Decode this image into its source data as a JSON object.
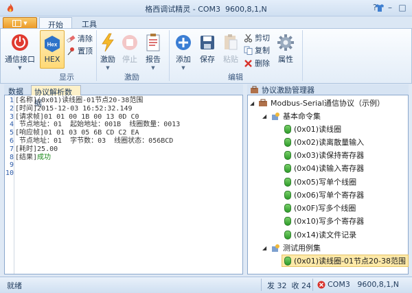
{
  "app_title": "格西调试精灵 - COM3  9600,8,1,N",
  "icons": [
    "flame-icon",
    "help-icon",
    "shirt-icon",
    "minimize-icon",
    "maximize-icon",
    "power-icon",
    "hex-icon",
    "eraser-icon",
    "pin-icon",
    "lightning-icon",
    "stop-icon",
    "report-icon",
    "add-icon",
    "save-icon",
    "paste-icon",
    "cut-icon",
    "copy-icon",
    "delete-icon",
    "gear-icon",
    "folder-icon",
    "toolbox-icon",
    "leaf-icon",
    "plug-icon"
  ],
  "ribbon": {
    "tabs": [
      "开始",
      "工具"
    ],
    "comm_port": "通信接口",
    "hex": "HEX",
    "hex_icon_text": "Hex",
    "clear": "清除",
    "pin_top": "置顶",
    "display_group": "显示",
    "stimulate": "激励",
    "stop": "停止",
    "report": "报告",
    "stimulate_group": "激励",
    "add": "添加",
    "save": "保存",
    "paste": "粘贴",
    "cut": "剪切",
    "copy": "复制",
    "delete": "删除",
    "properties": "属性",
    "edit_group": "编辑"
  },
  "left_panel": {
    "tabs": [
      "数据",
      "协议解析数据"
    ],
    "line_numbers": [
      "1",
      "2",
      "3",
      "4",
      "5",
      "6",
      "7",
      "8",
      "9",
      "10"
    ],
    "lines": [
      "[名称](0x01)读线圈-01节点20-38范围",
      "[时间]2015-12-03 16:52:32.149",
      "[请求帧]01 01 00 1B 00 13 0D C0",
      " 节点地址：01  起始地址：001B  线圈数量：0013",
      "[响应帧]01 01 03 05 6B CD C2 EA",
      " 节点地址：01  字节数：03  线圈状态：056BCD",
      "[耗时]25.00",
      "[结果]"
    ],
    "result_value": "成功"
  },
  "right_panel": {
    "title": "协议激励管理器",
    "root": "Modbus-Serial通信协议（示例）",
    "basic_group": "基本命令集",
    "basic_items": [
      "(0x01)读线圈",
      "(0x02)读离散量输入",
      "(0x03)读保持寄存器",
      "(0x04)读输入寄存器",
      "(0x05)写单个线圈",
      "(0x06)写单个寄存器",
      "(0x0F)写多个线圈",
      "(0x10)写多个寄存器",
      "(0x14)读文件记录"
    ],
    "test_group": "测试用例集",
    "test_items": [
      "(0x01)读线圈-01节点20-38范围"
    ]
  },
  "status": {
    "ready": "就绪",
    "counts": "发 32  收 24",
    "port": "COM3   9600,8,1,N"
  },
  "colors": {
    "result_ok": "#1a8a1a",
    "selected": "#fde9a8",
    "accent": "#e8a02e"
  }
}
